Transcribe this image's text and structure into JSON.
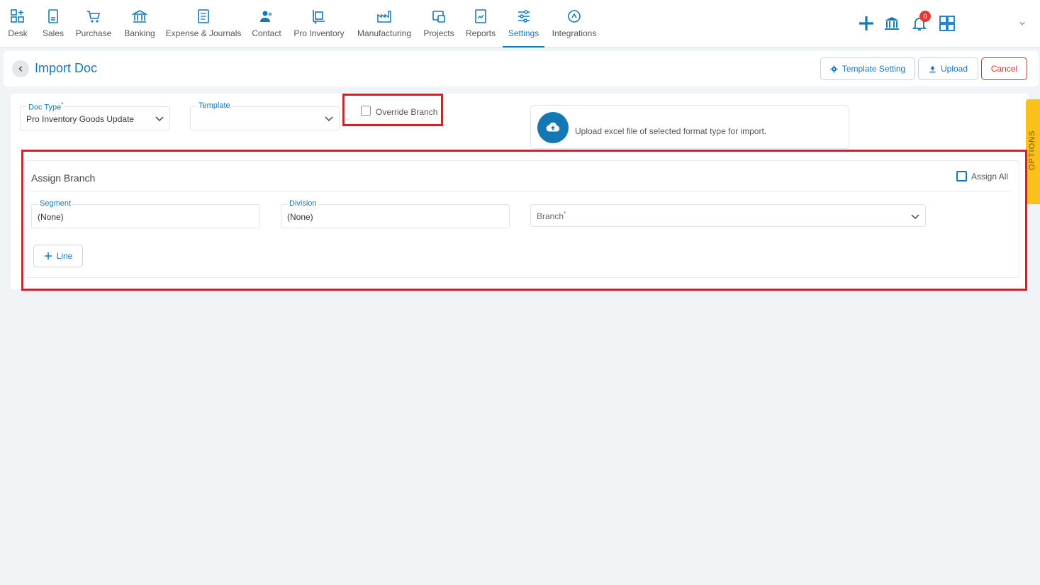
{
  "nav": {
    "items": [
      {
        "label": "Desk",
        "icon": "desk-icon"
      },
      {
        "label": "Sales",
        "icon": "sales-icon"
      },
      {
        "label": "Purchase",
        "icon": "cart-icon"
      },
      {
        "label": "Banking",
        "icon": "bank-icon"
      },
      {
        "label": "Expense & Journals",
        "icon": "journal-icon"
      },
      {
        "label": "Contact",
        "icon": "contact-icon"
      },
      {
        "label": "Pro Inventory",
        "icon": "inventory-icon"
      },
      {
        "label": "Manufacturing",
        "icon": "manufacturing-icon"
      },
      {
        "label": "Projects",
        "icon": "projects-icon"
      },
      {
        "label": "Reports",
        "icon": "reports-icon"
      },
      {
        "label": "Settings",
        "icon": "settings-icon"
      },
      {
        "label": "Integrations",
        "icon": "integrations-icon"
      }
    ],
    "active": "Settings",
    "notification_count": "0"
  },
  "header": {
    "title": "Import Doc",
    "template_setting_label": "Template Setting",
    "upload_label": "Upload",
    "cancel_label": "Cancel"
  },
  "form": {
    "doc_type_label": "Doc Type",
    "doc_type_required": "*",
    "doc_type_value": "Pro Inventory Goods Update",
    "template_label": "Template",
    "template_value": "",
    "override_branch_label": "Override Branch",
    "upload_hint": "Upload excel file of selected format type for import.",
    "options_tab_label": "OPTIONS"
  },
  "assign_branch": {
    "title": "Assign Branch",
    "assign_all_label": "Assign All",
    "segment_label": "Segment",
    "segment_value": "(None)",
    "division_label": "Division",
    "division_value": "(None)",
    "branch_label": "Branch",
    "branch_required": "*",
    "add_line_label": "Line"
  },
  "colors": {
    "accent": "#1478b4",
    "highlight": "#d0202e",
    "options_tab": "#f9c11a",
    "cancel": "#c0392b"
  }
}
